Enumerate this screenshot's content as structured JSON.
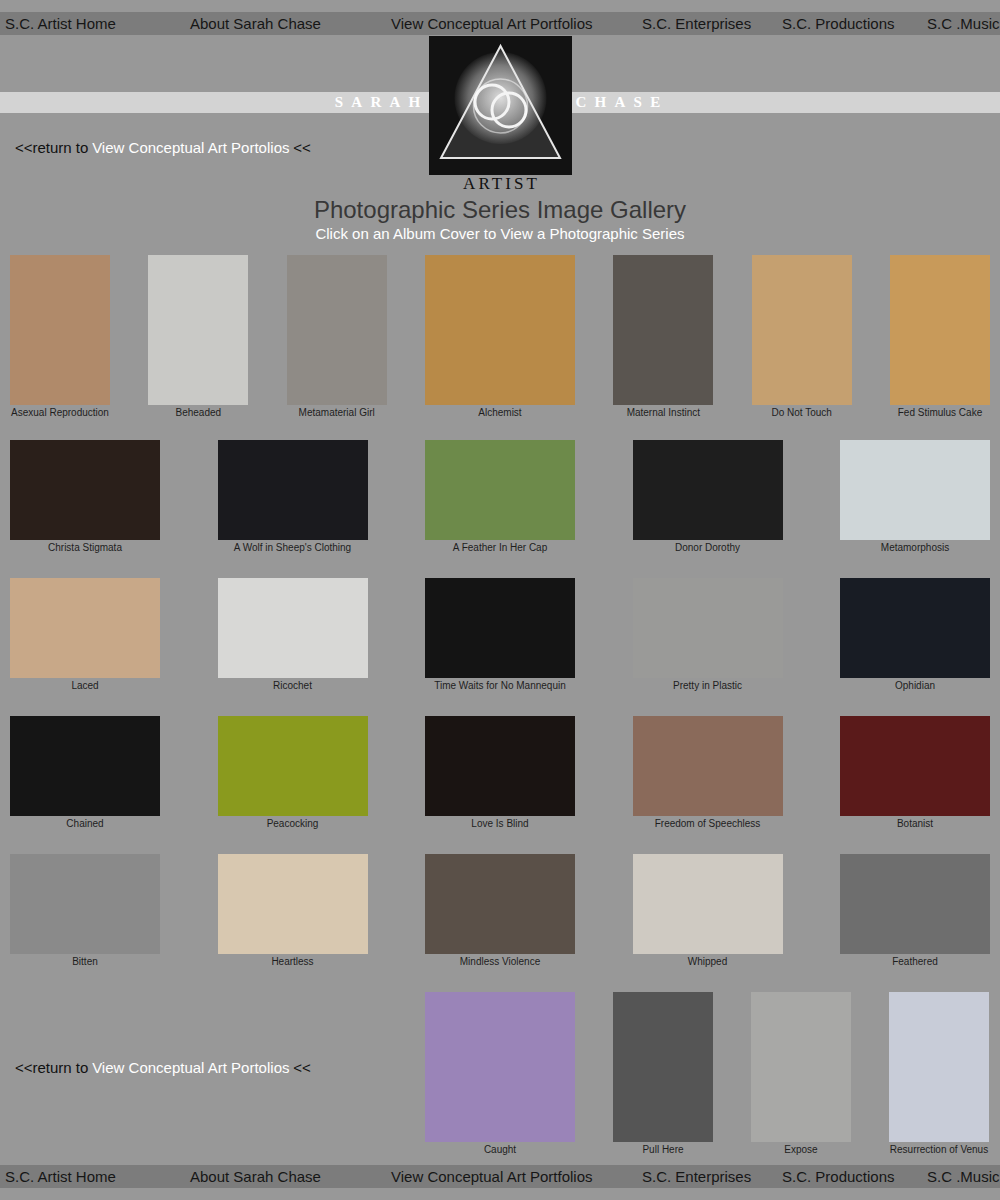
{
  "top_nav": [
    "S.C. Artist Home",
    "About Sarah Chase",
    "View Conceptual Art Portfolios",
    "S.C. Enterprises",
    "S.C. Productions",
    "S.C .Music"
  ],
  "brand": {
    "left": "SARAH",
    "right": "CHASE",
    "subtitle": "ARTIST"
  },
  "return_links": [
    {
      "prefix": "<<return to",
      "link": "View Conceptual Art Portolios",
      "suffix": "<<"
    },
    {
      "prefix": "<<return to",
      "link": "View Conceptual Art Portolios",
      "suffix": "<<"
    }
  ],
  "gallery": {
    "title": "Photographic Series Image Gallery",
    "subtitle": "Click on an Album Cover to View a Photographic Series",
    "rows": [
      [
        {
          "title": "Asexual Reproduction",
          "kind": "portrait",
          "color": "#b08a6a"
        },
        {
          "title": "Beheaded",
          "kind": "portrait",
          "color": "#c9c9c6"
        },
        {
          "title": "Metamaterial Girl",
          "kind": "portrait",
          "color": "#8f8b86"
        },
        {
          "title": "Alchemist",
          "kind": "square",
          "color": "#b88a48"
        },
        {
          "title": "Maternal Instinct",
          "kind": "portrait",
          "color": "#5a5550"
        },
        {
          "title": "Do Not Touch",
          "kind": "portrait",
          "color": "#c5a070"
        },
        {
          "title": "Fed Stimulus Cake",
          "kind": "portrait",
          "color": "#c89a5a"
        }
      ],
      [
        {
          "title": "Christa Stigmata",
          "kind": "landscape",
          "color": "#2a1f1a"
        },
        {
          "title": "A Wolf in Sheep's Clothing",
          "kind": "landscape",
          "color": "#1a1a1e"
        },
        {
          "title": "A Feather In Her Cap",
          "kind": "landscape",
          "color": "#6d8a4a"
        },
        {
          "title": "Donor Dorothy",
          "kind": "landscape",
          "color": "#1e1e1e"
        },
        {
          "title": "Metamorphosis",
          "kind": "landscape",
          "color": "#cfd6d8"
        }
      ],
      [
        {
          "title": "Laced",
          "kind": "landscape",
          "color": "#c8a888"
        },
        {
          "title": "Ricochet",
          "kind": "landscape",
          "color": "#d8d8d6"
        },
        {
          "title": "Time Waits for No Mannequin",
          "kind": "landscape",
          "color": "#141414"
        },
        {
          "title": "Pretty in Plastic",
          "kind": "landscape",
          "color": "#9a9a98"
        },
        {
          "title": "Ophidian",
          "kind": "landscape",
          "color": "#181c24"
        }
      ],
      [
        {
          "title": "Chained",
          "kind": "landscape",
          "color": "#151515"
        },
        {
          "title": "Peacocking",
          "kind": "landscape",
          "color": "#8a9a1e"
        },
        {
          "title": "Love Is Blind",
          "kind": "landscape",
          "color": "#1a1412"
        },
        {
          "title": "Freedom of Speechless",
          "kind": "landscape",
          "color": "#8a6a5a"
        },
        {
          "title": "Botanist",
          "kind": "landscape",
          "color": "#5a1a1a"
        }
      ],
      [
        {
          "title": "Bitten",
          "kind": "landscape",
          "color": "#8a8a8a"
        },
        {
          "title": "Heartless",
          "kind": "landscape",
          "color": "#d8c8b0"
        },
        {
          "title": "Mindless Violence",
          "kind": "landscape",
          "color": "#5a5048"
        },
        {
          "title": "Whipped",
          "kind": "landscape",
          "color": "#cfcac2"
        },
        {
          "title": "Feathered",
          "kind": "landscape",
          "color": "#6e6e6e"
        }
      ],
      [
        {
          "title": "Caught",
          "kind": "square",
          "color": "#9a84b8"
        },
        {
          "title": "Pull Here",
          "kind": "portrait",
          "color": "#555555"
        },
        {
          "title": "Expose",
          "kind": "portrait",
          "color": "#a8a8a6"
        },
        {
          "title": "Resurrection of Venus",
          "kind": "portrait",
          "color": "#c8ccd8"
        }
      ]
    ]
  },
  "bottom_nav": [
    "S.C. Artist Home",
    "About Sarah Chase",
    "View Conceptual Art Portfolios",
    "S.C. Enterprises",
    "S.C. Productions",
    "S.C .Music"
  ]
}
